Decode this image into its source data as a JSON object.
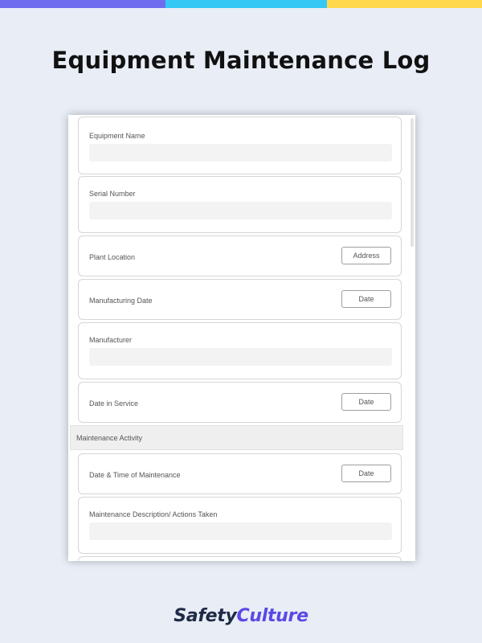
{
  "colors": {
    "background": "#e8edf6",
    "bar_blue": "#6f6cf0",
    "bar_cyan": "#35c8f5",
    "bar_yellow": "#ffd84d",
    "brand_dark": "#1f2a44",
    "brand_accent": "#5a48e6"
  },
  "page_title": "Equipment Maintenance Log",
  "form": {
    "fields": [
      {
        "label": "Equipment Name"
      },
      {
        "label": "Serial Number"
      },
      {
        "label": "Plant Location",
        "button": "Address"
      },
      {
        "label": "Manufacturing Date",
        "button": "Date"
      },
      {
        "label": "Manufacturer"
      },
      {
        "label": "Date in Service",
        "button": "Date"
      }
    ],
    "section_title": "Maintenance Activity",
    "activity_fields": [
      {
        "label": "Date & Time of Maintenance",
        "button": "Date"
      },
      {
        "label": "Maintenance Description/ Actions Taken"
      }
    ]
  },
  "brand": {
    "part1": "Safety",
    "part2": "Culture"
  }
}
